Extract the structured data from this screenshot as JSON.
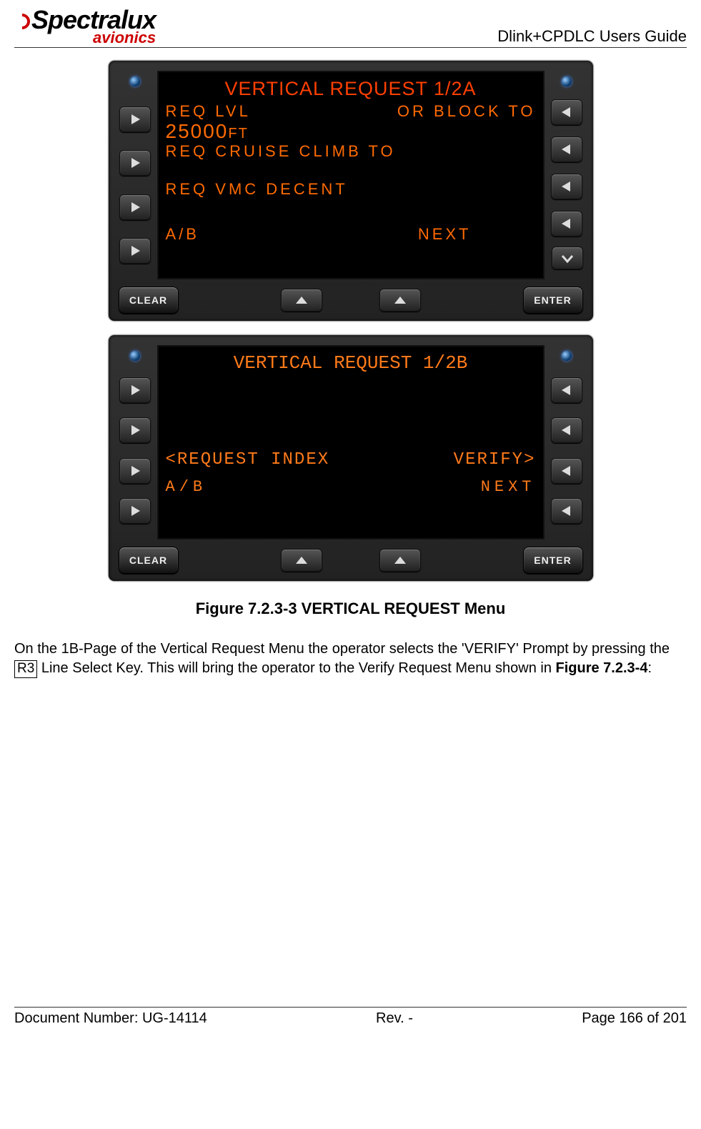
{
  "header": {
    "logo_main": "Spectralux",
    "logo_sub": "avionics",
    "guide_title": "Dlink+CPDLC Users Guide"
  },
  "device_a": {
    "title": "VERTICAL REQUEST 1/2A",
    "row1_left": "REQ LVL",
    "row1_right": "OR BLOCK TO",
    "value": "25000",
    "unit": "FT",
    "line2": "REQ CRUISE CLIMB TO",
    "line3": "REQ VMC DECENT",
    "bottom_left": "A/B",
    "bottom_right": "NEXT",
    "clear": "CLEAR",
    "enter": "ENTER"
  },
  "device_b": {
    "title": "VERTICAL REQUEST 1/2B",
    "row_left": "<REQUEST INDEX",
    "row_right": "VERIFY>",
    "bottom_left": "A/B",
    "bottom_right": "NEXT",
    "clear": "CLEAR",
    "enter": "ENTER"
  },
  "caption": "Figure 7.2.3-3 VERTICAL REQUEST Menu",
  "paragraph": {
    "pre": " On the 1B-Page of the Vertical Request Menu the operator selects the 'VERIFY' Prompt by pressing the ",
    "key": "R3",
    "mid": " Line Select Key.  This will bring the operator to the Verify Request Menu shown in ",
    "ref": "Figure 7.2.3-4",
    "post": ":"
  },
  "footer": {
    "left": "Document Number:  UG-14114",
    "mid": "Rev. -",
    "right": "Page 166 of 201"
  }
}
